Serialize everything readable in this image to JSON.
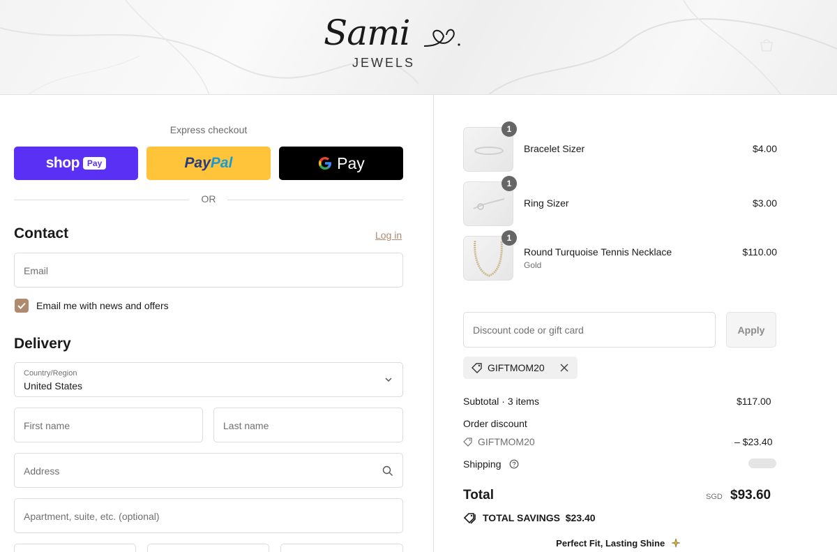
{
  "header": {
    "logo_script": "Sami",
    "logo_sub": "JEWELS"
  },
  "express": {
    "label": "Express checkout",
    "shop_text": "shop",
    "shop_pay": "Pay",
    "paypal_a": "Pay",
    "paypal_b": "Pal",
    "gpay": "Pay",
    "or": "OR"
  },
  "contact": {
    "title": "Contact",
    "login": "Log in",
    "email_placeholder": "Email",
    "newsletter_label": "Email me with news and offers",
    "newsletter_checked": true
  },
  "delivery": {
    "title": "Delivery",
    "country_label": "Country/Region",
    "country_value": "United States",
    "first_name_placeholder": "First name",
    "last_name_placeholder": "Last name",
    "address_placeholder": "Address",
    "apartment_placeholder": "Apartment, suite, etc. (optional)"
  },
  "cart": {
    "items": [
      {
        "name": "Bracelet Sizer",
        "variant": "",
        "qty": "1",
        "price": "$4.00"
      },
      {
        "name": "Ring Sizer",
        "variant": "",
        "qty": "1",
        "price": "$3.00"
      },
      {
        "name": "Round Turquoise Tennis Necklace",
        "variant": "Gold",
        "qty": "1",
        "price": "$110.00"
      }
    ],
    "discount_placeholder": "Discount code or gift card",
    "apply_label": "Apply",
    "applied_code": "GIFTMOM20"
  },
  "summary": {
    "subtotal_label": "Subtotal · 3 items",
    "subtotal_value": "$117.00",
    "order_discount_label": "Order discount",
    "discount_code": "GIFTMOM20",
    "discount_value": "– $23.40",
    "shipping_label": "Shipping",
    "total_label": "Total",
    "currency": "SGD",
    "total_value": "$93.60",
    "savings_label": "TOTAL SAVINGS",
    "savings_value": "$23.40",
    "promo": "Perfect Fit, Lasting Shine"
  },
  "colors": {
    "shop_pay": "#5a31f4",
    "paypal": "#ffc439",
    "accent": "#b08a6e"
  }
}
